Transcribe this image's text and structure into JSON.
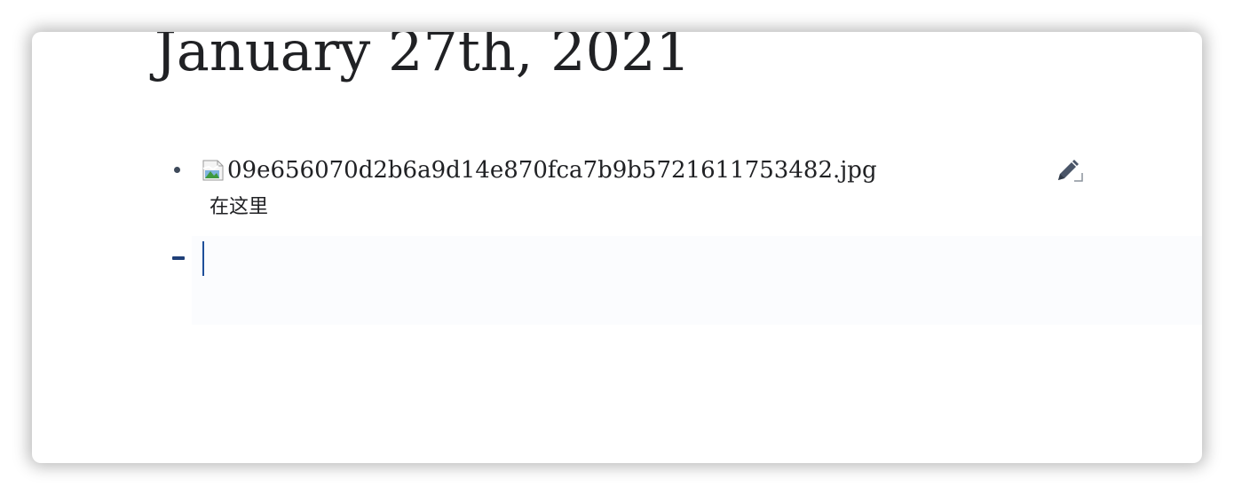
{
  "page": {
    "title": "January 27th, 2021"
  },
  "blocks": [
    {
      "image_alt": "09e656070d2b6a9d14e870fca7b9b5721611753482.jpg",
      "caption": "在这里"
    }
  ],
  "editor": {
    "current_value": ""
  },
  "icons": {
    "edit": "pencil-edit-icon",
    "broken_image": "broken-image-icon",
    "bullet": "bullet-dot"
  },
  "colors": {
    "text": "#202124",
    "accent": "#1f4f9a",
    "dash": "#1f3f78",
    "bullet": "#3e4a5a",
    "edit_icon": "#4a5568"
  }
}
